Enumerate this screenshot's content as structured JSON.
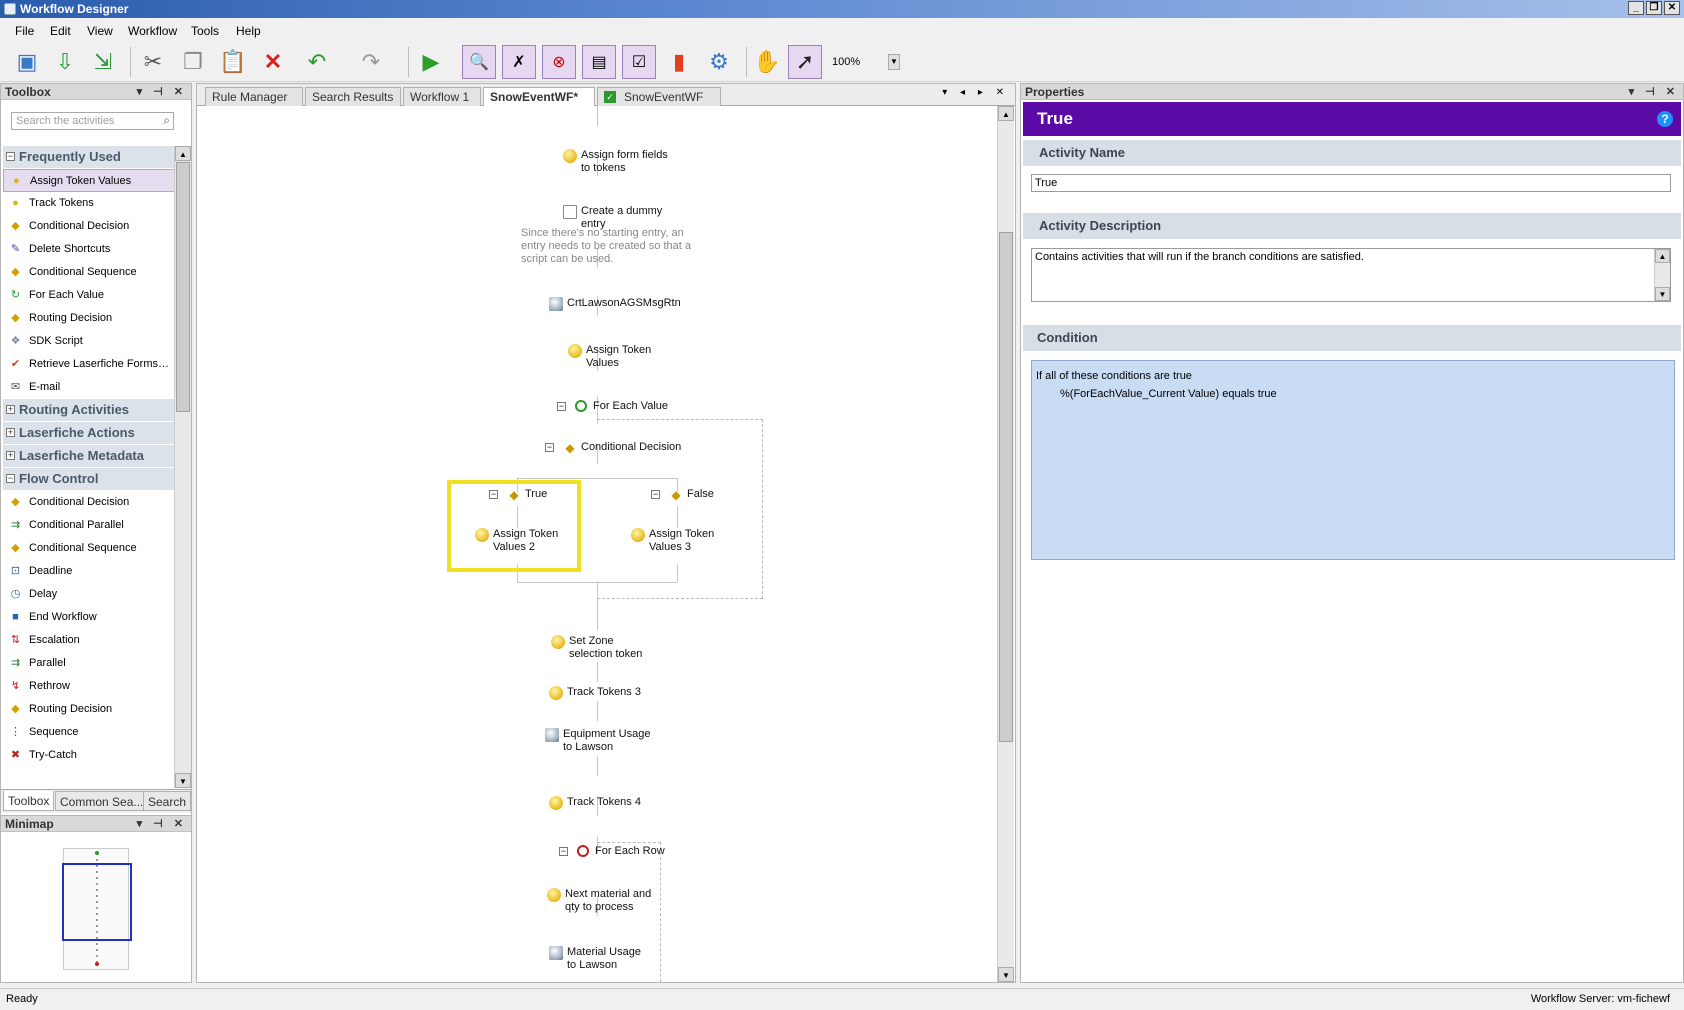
{
  "window": {
    "title": "Workflow Designer"
  },
  "menu": [
    "File",
    "Edit",
    "View",
    "Workflow",
    "Tools",
    "Help"
  ],
  "toolbar": {
    "zoom": "100%"
  },
  "toolbox": {
    "title": "Toolbox",
    "search_placeholder": "Search the activities",
    "categories": [
      {
        "label": "Frequently Used",
        "expanded": true,
        "items": [
          {
            "label": "Assign Token Values",
            "icon": "token-icon",
            "selected": true
          },
          {
            "label": "Track Tokens",
            "icon": "token-icon"
          },
          {
            "label": "Conditional Decision",
            "icon": "decision-icon"
          },
          {
            "label": "Delete Shortcuts",
            "icon": "delete-shortcut-icon"
          },
          {
            "label": "Conditional Sequence",
            "icon": "decision-icon"
          },
          {
            "label": "For Each Value",
            "icon": "loop-icon"
          },
          {
            "label": "Routing Decision",
            "icon": "decision-icon"
          },
          {
            "label": "SDK Script",
            "icon": "script-icon"
          },
          {
            "label": "Retrieve Laserfiche Forms…",
            "icon": "forms-icon"
          },
          {
            "label": "E-mail",
            "icon": "email-icon"
          }
        ]
      },
      {
        "label": "Routing Activities",
        "expanded": false,
        "items": []
      },
      {
        "label": "Laserfiche Actions",
        "expanded": false,
        "items": []
      },
      {
        "label": "Laserfiche Metadata",
        "expanded": false,
        "items": []
      },
      {
        "label": "Flow Control",
        "expanded": true,
        "items": [
          {
            "label": "Conditional Decision",
            "icon": "decision-icon"
          },
          {
            "label": "Conditional Parallel",
            "icon": "parallel-icon"
          },
          {
            "label": "Conditional Sequence",
            "icon": "decision-icon"
          },
          {
            "label": "Deadline",
            "icon": "deadline-icon"
          },
          {
            "label": "Delay",
            "icon": "clock-icon"
          },
          {
            "label": "End Workflow",
            "icon": "end-icon"
          },
          {
            "label": "Escalation",
            "icon": "escalation-icon"
          },
          {
            "label": "Parallel",
            "icon": "parallel-icon"
          },
          {
            "label": "Rethrow",
            "icon": "rethrow-icon"
          },
          {
            "label": "Routing Decision",
            "icon": "decision-icon"
          },
          {
            "label": "Sequence",
            "icon": "sequence-icon"
          },
          {
            "label": "Try-Catch",
            "icon": "try-catch-icon"
          }
        ]
      }
    ],
    "tabs": [
      "Toolbox",
      "Common Sea...",
      "Search"
    ]
  },
  "minimap": {
    "title": "Minimap"
  },
  "designer": {
    "tabs": [
      {
        "label": "Rule Manager",
        "active": false
      },
      {
        "label": "Search Results",
        "active": false
      },
      {
        "label": "Workflow 1",
        "active": false
      },
      {
        "label": "SnowEventWF*",
        "active": true
      },
      {
        "label": "SnowEventWF",
        "active": false
      }
    ],
    "nodes": {
      "assign_form": "Assign form fields\nto tokens",
      "create_dummy": "Create a dummy\nentry",
      "create_dummy_note": "Since there's no starting entry, an entry needs to be created so that a script can be used.",
      "crt_lawson": "CrtLawsonAGSMsgRtn",
      "assign_token": "Assign Token\nValues",
      "for_each_value": "For Each Value",
      "conditional_decision": "Conditional Decision",
      "branch_true": "True",
      "branch_false": "False",
      "assign_token_2": "Assign Token\nValues 2",
      "assign_token_3": "Assign Token\nValues 3",
      "set_zone": "Set Zone\nselection token",
      "track_tokens_3": "Track Tokens 3",
      "equipment_usage": "Equipment Usage\nto Lawson",
      "track_tokens_4": "Track Tokens 4",
      "for_each_row": "For Each Row",
      "next_material": "Next material and\nqty to process",
      "material_usage": "Material Usage\nto Lawson"
    }
  },
  "properties": {
    "panel_title": "Properties",
    "header": "True",
    "activity_name_label": "Activity Name",
    "activity_name_value": "True",
    "activity_desc_label": "Activity Description",
    "activity_desc_value": "Contains activities that will run if the branch conditions are satisfied.",
    "condition_label": "Condition",
    "condition_line1": "If all of these conditions are true",
    "condition_line2": "%(ForEachValue_Current Value) equals true"
  },
  "status": {
    "left": "Ready",
    "right": "Workflow Server: vm-fichewf"
  }
}
